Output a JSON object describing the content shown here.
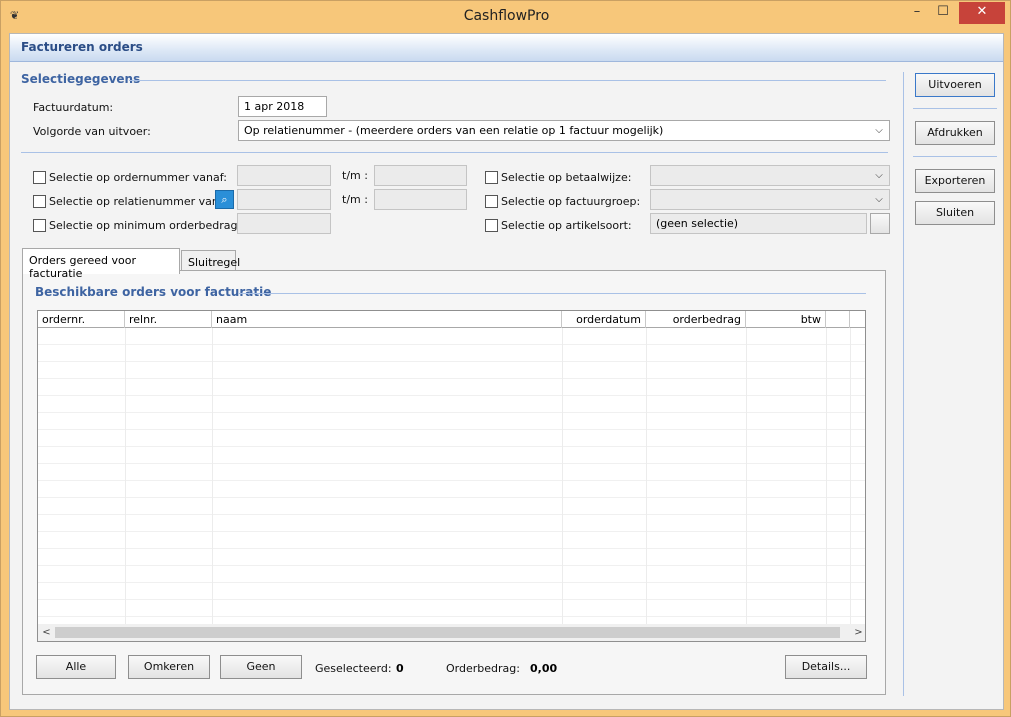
{
  "window": {
    "title": "CashflowPro",
    "minimize_glyph": "–",
    "maximize_glyph": "☐",
    "close_glyph": "✕",
    "app_icon_glyph": "❦"
  },
  "header": {
    "title": "Factureren orders"
  },
  "selection": {
    "title": "Selectiegegevens",
    "factuurdatum_label": "Factuurdatum:",
    "factuurdatum_value": "1 apr 2018",
    "volgorde_label": "Volgorde van uitvoer:",
    "volgorde_value": "Op relatienummer - (meerdere orders van een relatie op 1 factuur mogelijk)",
    "ordernummer_label": "Selectie op ordernummer vanaf:",
    "relatienummer_label": "Selectie op relatienummer vanaf:",
    "minimum_label": "Selectie op minimum orderbedrag:",
    "tm_label": "t/m :",
    "betaalwijze_label": "Selectie op betaalwijze:",
    "factuurgroep_label": "Selectie op factuurgroep:",
    "artikelsoort_label": "Selectie op artikelsoort:",
    "artikelsoort_value": "(geen selectie)",
    "dropdown_arrow": "⌵"
  },
  "actions": {
    "uitvoeren": "Uitvoeren",
    "afdrukken": "Afdrukken",
    "exporteren": "Exporteren",
    "sluiten": "Sluiten"
  },
  "tabs": [
    {
      "label": "Orders gereed voor facturatie"
    },
    {
      "label": "Sluitregel"
    }
  ],
  "orders": {
    "title": "Beschikbare orders voor facturatie",
    "columns": [
      "ordernr.",
      "relnr.",
      "naam",
      "orderdatum",
      "orderbedrag",
      "btw"
    ],
    "rows": [],
    "scroll_left": "<",
    "scroll_right": ">"
  },
  "footer": {
    "alle": "Alle",
    "omkeren": "Omkeren",
    "geen": "Geen",
    "geselecteerd_label": "Geselecteerd:",
    "geselecteerd_value": "0",
    "orderbedrag_label": "Orderbedrag:",
    "orderbedrag_value": "0,00",
    "details": "Details..."
  },
  "colors": {
    "accent": "#3e64a2",
    "divider": "#a9c1e6",
    "frame": "#f7c77a",
    "close": "#c7433a"
  }
}
